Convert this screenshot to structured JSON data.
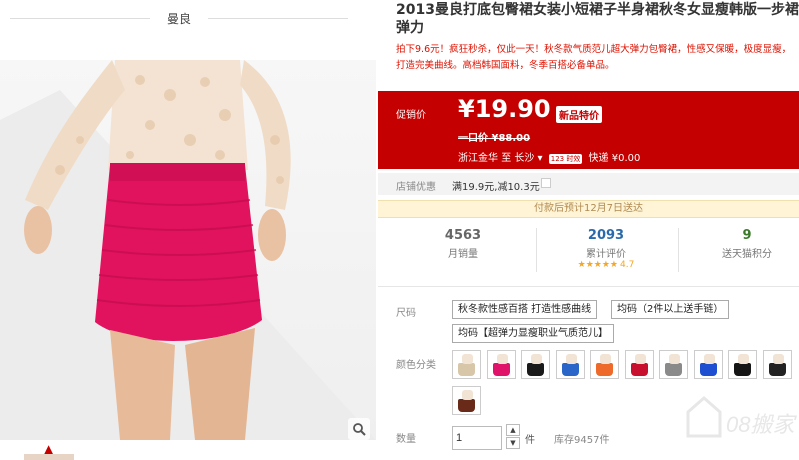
{
  "gallery": {
    "brand_name": "曼良",
    "zoom_icon": "magnifier-icon",
    "thumb_prev_icon": "chevron-up-icon"
  },
  "product": {
    "title": "2013曼良打底包臀裙女装小短裙子半身裙秋冬女显瘦韩版一步裙弹力",
    "subtitle": "拍下9.6元！疯狂秒杀，仅此一天！秋冬款气质范儿超大弹力包臀裙，性感又保暖，极度显瘦，打造完美曲线。高档韩国面料，冬季百搭必备单品。"
  },
  "price": {
    "label": "促销价",
    "value": "¥19.90",
    "badge": "新品特价",
    "original_label": "一口价",
    "original_currency": "¥",
    "original_value": "88.00",
    "ship_from": "浙江金华",
    "ship_to_word": "至",
    "ship_to": "长沙",
    "ship_tag": "123 时效",
    "ship_method": "快递",
    "ship_fee": "¥0.00",
    "accent_color": "#c40000"
  },
  "promo": {
    "label": "店铺优惠",
    "value": "满19.9元,减10.3元"
  },
  "notice": "付款后预计12月7日送达",
  "stats": {
    "sales_num": "4563",
    "sales_label": "月销量",
    "reviews_num": "2093",
    "reviews_label": "累计评价",
    "rating_stars": "★★★★★",
    "rating": "4.7",
    "points_num": "9",
    "points_label": "送天猫积分"
  },
  "size": {
    "label": "尺码",
    "options": [
      "秋冬款性感百搭 打造性感曲线",
      "均码（2件以上送手链）",
      "均码【超弹力显瘦职业气质范儿】"
    ]
  },
  "colors": {
    "label": "颜色分类",
    "swatches": [
      "#d8c6a8",
      "#e0136a",
      "#1a1a1a",
      "#2a66c8",
      "#ee6a2a",
      "#c8102e",
      "#8a8a8a",
      "#1e4fd0",
      "#151515",
      "#222222",
      "#6a2a1a"
    ]
  },
  "quantity": {
    "label": "数量",
    "value": "1",
    "unit": "件",
    "stock": "库存9457件",
    "up_icon": "chevron-up-icon",
    "down_icon": "chevron-down-icon"
  }
}
